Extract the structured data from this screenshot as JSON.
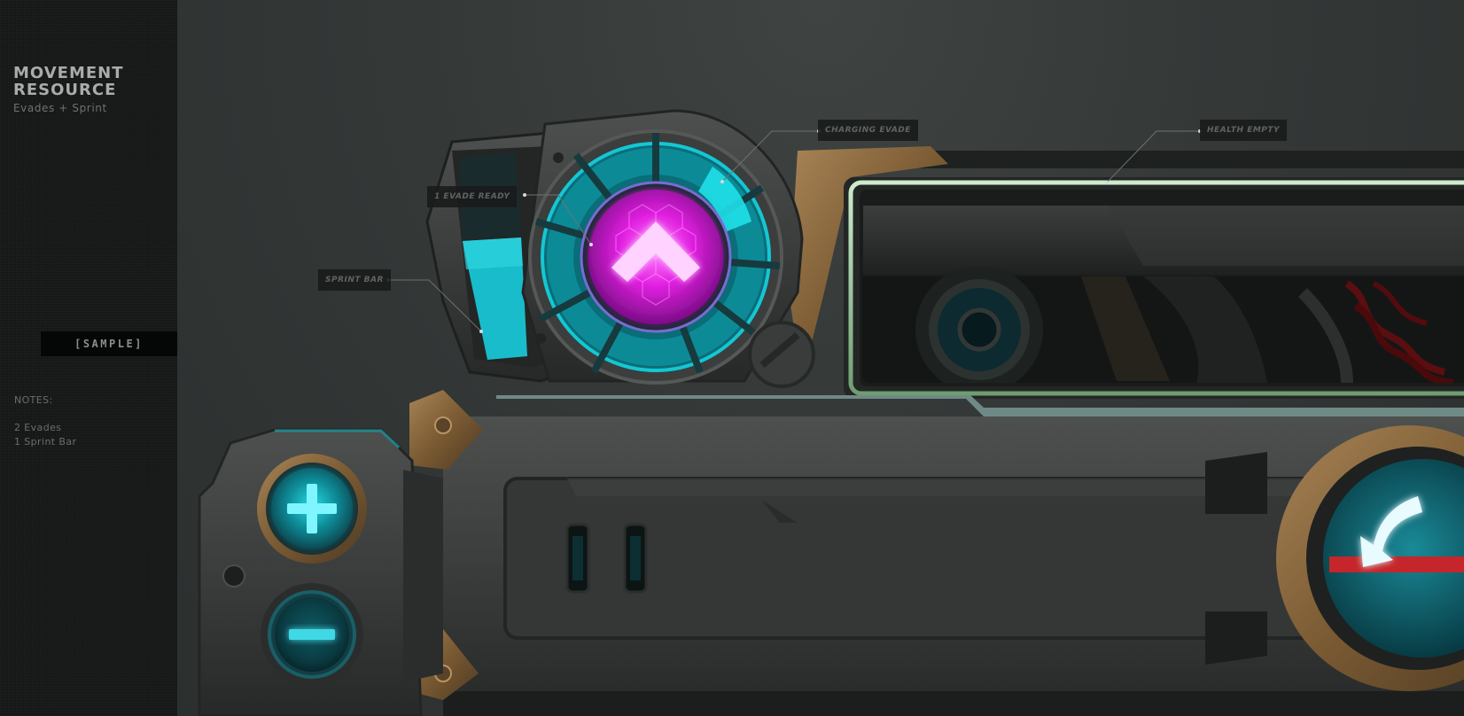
{
  "panel": {
    "title": "MOVEMENT\nRESOURCE",
    "subtitle": "Evades + Sprint",
    "sample_label": "[SAMPLE]",
    "notes_label": "NOTES:",
    "notes": [
      "2 Evades",
      "1 Sprint Bar"
    ]
  },
  "callouts": {
    "sprint_bar": "SPRINT BAR",
    "evade_ready": "1 EVADE READY",
    "charging_evade": "CHARGING EVADE",
    "health_empty": "HEALTH EMPTY"
  },
  "hud": {
    "plus_icon": "plus-icon",
    "minus_icon": "minus-icon",
    "evade_icon": "chevron-up-icon",
    "dodge_icon": "curved-arrow-icon"
  },
  "colors": {
    "accent_cyan": "#19c9d4",
    "evade_magenta": "#e21ce0",
    "health_frame_green": "#a9d8a8",
    "brass": "#8c6a3e",
    "danger_red": "#c4262b"
  }
}
